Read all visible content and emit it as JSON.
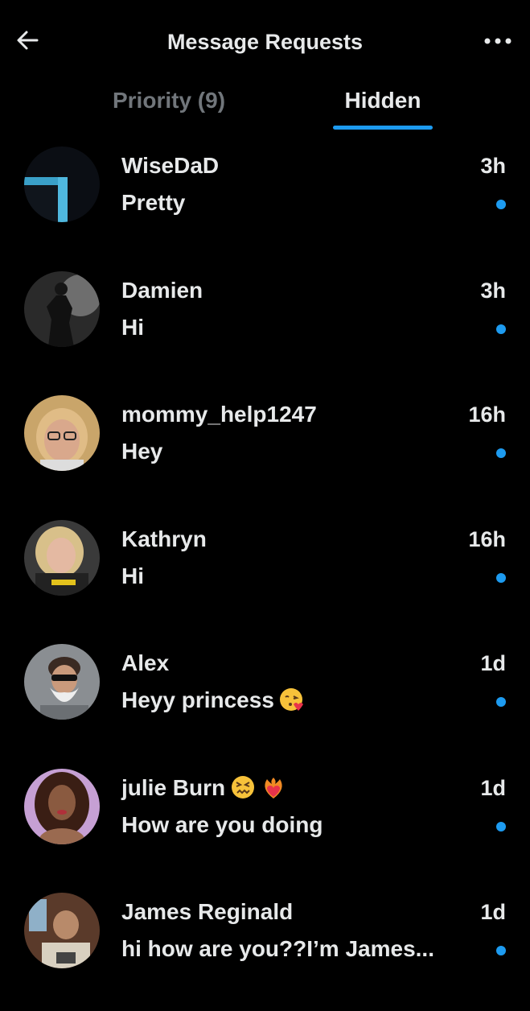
{
  "header": {
    "title": "Message Requests",
    "back_icon": "arrow-left-icon",
    "more_icon": "more-horizontal-icon"
  },
  "tabs": [
    {
      "label": "Priority (9)",
      "active": false
    },
    {
      "label": "Hidden",
      "active": true
    }
  ],
  "colors": {
    "background": "#000000",
    "text": "#e7e9ea",
    "muted": "#71767b",
    "accent": "#1d9bf0"
  },
  "conversations": [
    {
      "name": "WiseDaD",
      "preview": "Pretty",
      "time": "3h",
      "unread": true
    },
    {
      "name": "Damien",
      "preview": "Hi",
      "time": "3h",
      "unread": true
    },
    {
      "name": "mommy_help1247",
      "preview": "Hey",
      "time": "16h",
      "unread": true
    },
    {
      "name": "Kathryn",
      "preview": "Hi",
      "time": "16h",
      "unread": true
    },
    {
      "name": "Alex",
      "preview": "Heyy princess",
      "preview_emoji": "face-blowing-kiss",
      "time": "1d",
      "unread": true
    },
    {
      "name": "julie Burn",
      "name_emojis": [
        "confounded-face",
        "heart-on-fire"
      ],
      "preview": "How are you doing",
      "time": "1d",
      "unread": true
    },
    {
      "name": "James Reginald",
      "preview": "hi how are you??I’m James...",
      "time": "1d",
      "unread": true
    }
  ]
}
